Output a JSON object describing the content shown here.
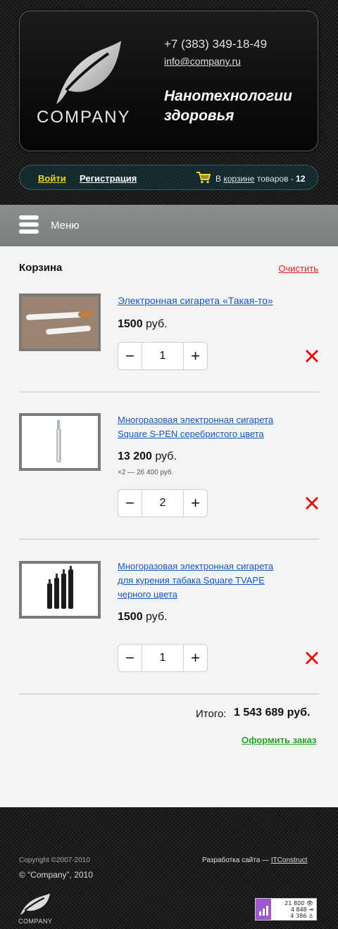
{
  "header": {
    "logo_text": "COMPANY",
    "phone": "+7 (383) 349-18-49",
    "email": "info@company.ru",
    "slogan_line1": "Нанотехнологии",
    "slogan_line2": "здоровья"
  },
  "userbar": {
    "login": "Войти",
    "register": "Регистрация",
    "cart_prefix": "В",
    "cart_link": "корзине",
    "cart_middle": "товаров -",
    "cart_count": "12"
  },
  "menu": {
    "label": "Меню"
  },
  "cart": {
    "title": "Корзина",
    "clear": "Очистить",
    "items": [
      {
        "name": "Электронная сигарета «Такая-то»",
        "price_number": "1500",
        "price_currency": "руб.",
        "sub": "",
        "qty": "1"
      },
      {
        "name_line1": "Многоразовая электронная сигарета",
        "name_line2": "Square S-PEN серебристого цвета",
        "price_number": "13 200",
        "price_currency": "руб.",
        "sub": "×2 — 26 400 руб.",
        "qty": "2"
      },
      {
        "name_line1": "Многоразовая электронная сигарета",
        "name_line2": "для курения табака Square TVAPE",
        "name_line3": "черного цвета",
        "price_number": "1500",
        "price_currency": "руб.",
        "sub": "",
        "qty": "1"
      }
    ],
    "total_label": "Итого:",
    "total_value": "1 543 689 руб.",
    "order": "Оформить заказ"
  },
  "footer": {
    "copyright": "Copyright ©2007-2010",
    "company": "© “Company”, 2010",
    "dev_prefix": "Разработка сайта —",
    "dev_link": "ITConstruct",
    "logo_text": "COMPANY",
    "counter": {
      "views": "21 800",
      "visits": "4 848",
      "visitors": "4 386"
    }
  },
  "colors": {
    "accent_link": "#1a56b8",
    "clear_red": "#d42121",
    "order_green": "#2aa12a",
    "login_yellow": "#f5d130"
  }
}
